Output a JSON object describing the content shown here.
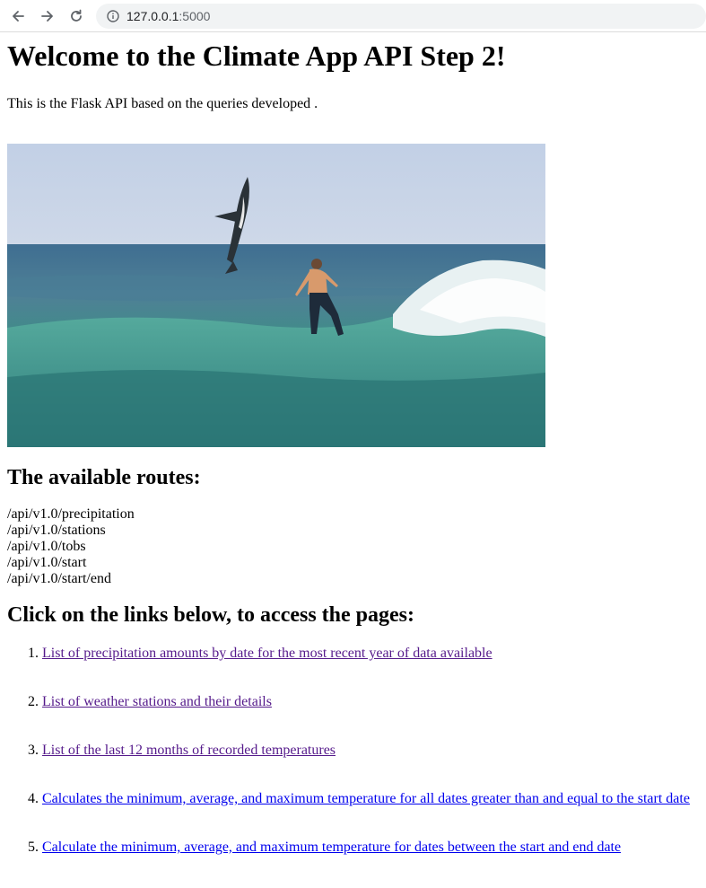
{
  "browser": {
    "url_host": "127.0.0.1",
    "url_port": ":5000"
  },
  "page": {
    "title": "Welcome to the Climate App API Step 2!",
    "intro": "This is the Flask API based on the queries developed ."
  },
  "routes_section": {
    "heading": "The available routes:",
    "routes": [
      "/api/v1.0/precipitation",
      "/api/v1.0/stations",
      "/api/v1.0/tobs",
      "/api/v1.0/start",
      "/api/v1.0/start/end"
    ]
  },
  "links_section": {
    "heading": "Click on the links below, to access the pages:",
    "links": [
      {
        "label": "List of precipitation amounts by date for the most recent year of data available",
        "visited": true
      },
      {
        "label": "List of weather stations and their details",
        "visited": true
      },
      {
        "label": "List of the last 12 months of recorded temperatures",
        "visited": true
      },
      {
        "label": "Calculates the minimum, average, and maximum temperature for all dates greater than and equal to the start date",
        "visited": false
      },
      {
        "label": "Calculate the minimum, average, and maximum temperature for dates between the start and end date",
        "visited": false
      }
    ]
  },
  "colors": {
    "link_visited": "#551a8b",
    "link_unvisited": "#0000ee"
  }
}
